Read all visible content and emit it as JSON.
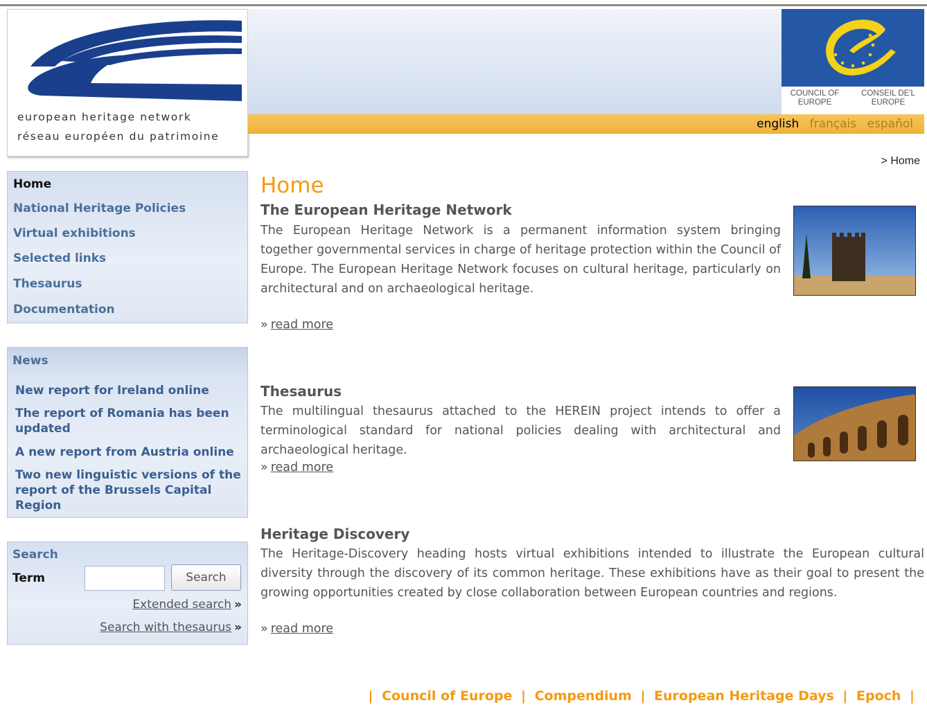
{
  "header": {
    "logo_line1": "european heritage network",
    "logo_line2": "réseau européen du patrimoine",
    "coe_en": "COUNCIL OF EUROPE",
    "coe_fr": "CONSEIL DE'L EUROPE",
    "languages": [
      "english",
      "français",
      "español"
    ],
    "active_language": "english"
  },
  "breadcrumb": "> Home",
  "nav": {
    "items": [
      "Home",
      "National Heritage Policies",
      "Virtual exhibitions",
      "Selected links",
      "Thesaurus",
      "Documentation"
    ]
  },
  "news": {
    "title": "News",
    "items": [
      "New report for Ireland online",
      "The report of Romania has been updated",
      "A new report from Austria online",
      "Two new linguistic versions of the report of the Brussels Capital Region"
    ]
  },
  "search": {
    "title": "Search",
    "term_label": "Term",
    "button": "Search",
    "extended": "Extended search",
    "thesaurus": "Search with thesaurus",
    "arrow": "»"
  },
  "main": {
    "title": "Home",
    "read_more_prefix": "»",
    "read_more": "read more",
    "sections": [
      {
        "title": "The European Heritage Network",
        "text": "The European Heritage Network is a permanent information system bringing together governmental services in charge of heritage protection within the Council of Europe. The European Heritage Network focuses on cultural heritage, particularly on architectural and on archaeological heritage."
      },
      {
        "title": "Thesaurus",
        "text": "The multilingual thesaurus attached to the HEREIN project intends to offer a terminological standard for national policies dealing with architectural and archaeological heritage."
      },
      {
        "title": "Heritage Discovery",
        "text": "The Heritage-Discovery heading hosts virtual exhibitions intended to illustrate the European cultural diversity through the discovery of its common heritage. These exhibitions have as their goal to present the growing opportunities created by close collaboration between European countries and regions."
      }
    ]
  },
  "footer": {
    "links": [
      "Council of Europe",
      "Compendium",
      "European Heritage Days",
      "Epoch"
    ],
    "separator": "|"
  },
  "colors": {
    "accent_orange": "#f59a10",
    "nav_blue": "#4b6f9b",
    "coe_blue": "#2458a6",
    "lang_bar": "#f0b43f"
  }
}
